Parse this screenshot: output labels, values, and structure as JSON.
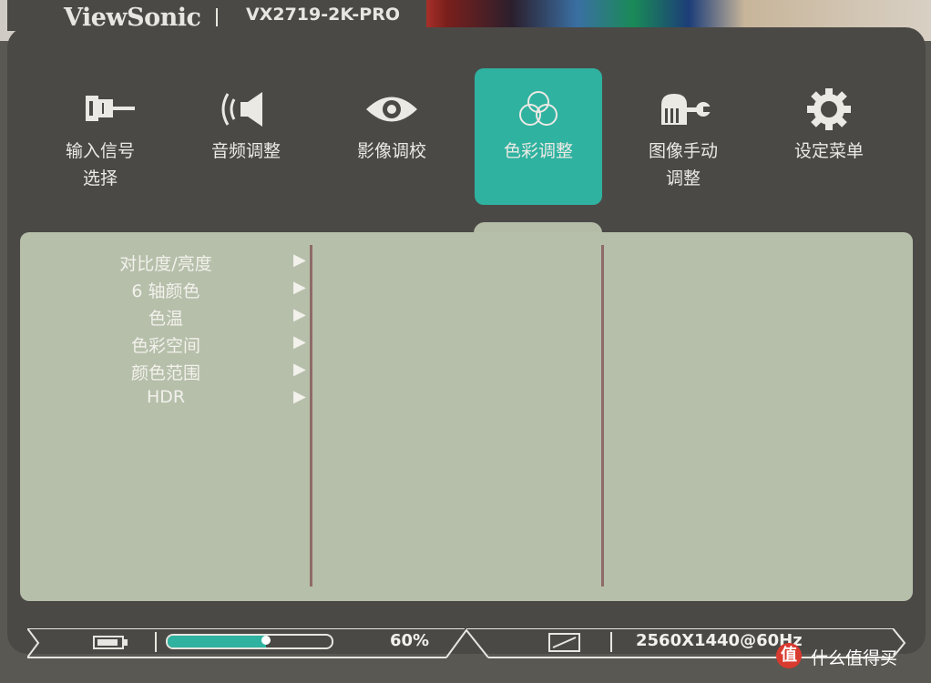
{
  "brand": {
    "name": "ViewSonic",
    "model": "VX2719-2K-PRO"
  },
  "tabs": [
    {
      "label": "输入信号\n选择",
      "icon": "input-plug-icon"
    },
    {
      "label": "音频调整",
      "icon": "speaker-icon"
    },
    {
      "label": "影像调校",
      "icon": "eye-icon"
    },
    {
      "label": "色彩调整",
      "icon": "color-circles-icon",
      "active": true
    },
    {
      "label": "图像手动\n调整",
      "icon": "hand-wrench-icon"
    },
    {
      "label": "设定菜单",
      "icon": "gear-icon"
    }
  ],
  "menu": {
    "items": [
      {
        "label": "对比度/亮度"
      },
      {
        "label": "6 轴颜色"
      },
      {
        "label": "色温"
      },
      {
        "label": "色彩空间"
      },
      {
        "label": "颜色范围"
      },
      {
        "label": "HDR"
      }
    ],
    "arrow": "▶"
  },
  "status": {
    "volume_percent": 60,
    "volume_text": "60%",
    "resolution": "2560X1440@60Hz"
  },
  "watermark": {
    "logo": "值",
    "text": "什么值得买"
  },
  "colors": {
    "accent": "#2fb2a0",
    "panel": "#b6bfaa",
    "osd": "#4b4946",
    "divider": "#8e6a68"
  }
}
